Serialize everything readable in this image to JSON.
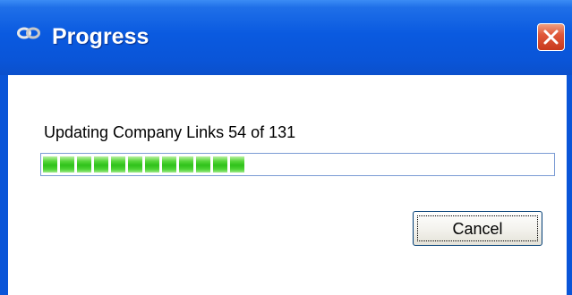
{
  "window": {
    "title": "Progress",
    "title_icon": "chain-link-icon",
    "close_icon": "close-icon",
    "accent": "#0a55d8",
    "close_color": "#e0583a"
  },
  "progress": {
    "message": "Updating Company Links 54 of 131",
    "current": 54,
    "total": 131,
    "fill_color": "#2fc21a"
  },
  "buttons": {
    "cancel_label": "Cancel"
  }
}
